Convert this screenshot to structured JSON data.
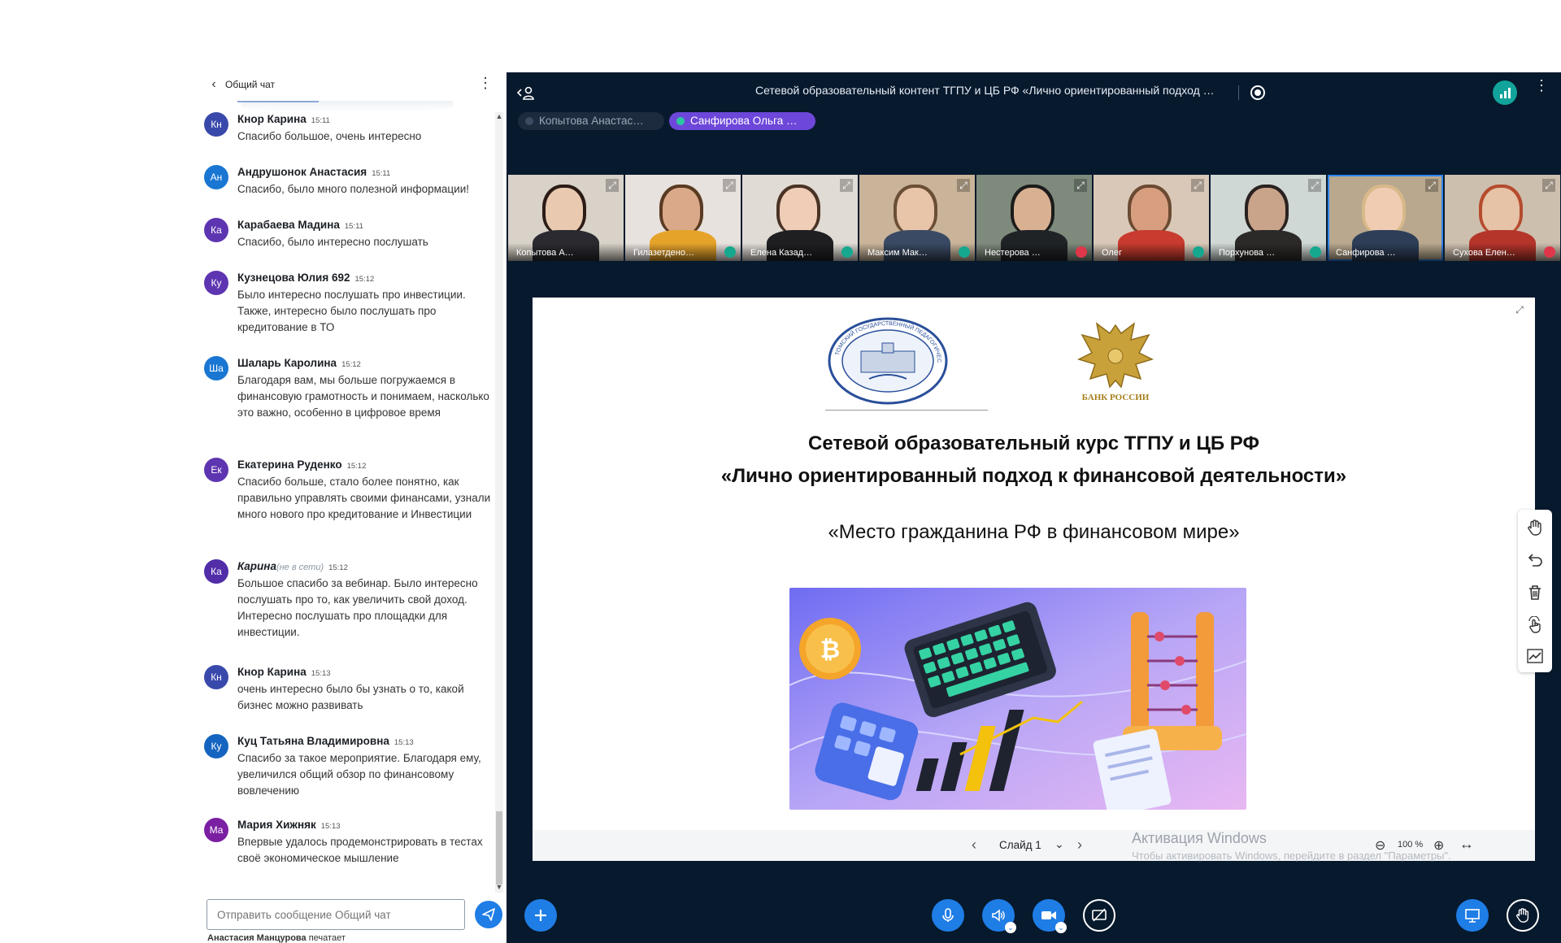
{
  "chat": {
    "title": "Общий чат",
    "messages": [
      {
        "initials": "Кн",
        "color": "#3949ab",
        "name": "Кнор Карина",
        "time": "15:11",
        "text": "Спасибо большое, очень интересно"
      },
      {
        "initials": "Ан",
        "color": "#1976d2",
        "name": "Андрушонок Анастасия",
        "time": "15:11",
        "text": "Спасибо, было много полезной информации!"
      },
      {
        "initials": "Ка",
        "color": "#5e35b1",
        "name": "Карабаева Мадина",
        "time": "15:11",
        "text": "Спасибо, было интересно послушать"
      },
      {
        "initials": "Ку",
        "color": "#5e35b1",
        "name": "Кузнецова Юлия 692",
        "time": "15:12",
        "text": "Было интересно послушать про инвестиции. Также, интересно было послушать про кредитование в ТО"
      },
      {
        "initials": "Ша",
        "color": "#1976d2",
        "name": "Шаларь Каролина",
        "time": "15:12",
        "text": "Благодаря вам, мы больше погружаемся в финансовую грамотность и понимаем, насколько это важно, особенно в цифровое время"
      },
      {
        "initials": "Ек",
        "color": "#5e35b1",
        "name": "Екатерина Руденко",
        "time": "15:12",
        "text": "Спасибо больше, стало более понятно, как правильно управлять своими финансами, узнали много нового про кредитование и Инвестиции"
      },
      {
        "initials": "Ка",
        "color": "#512da8",
        "name": "Карина",
        "offline": "(не в сети)",
        "time": "15:12",
        "text": "Большое спасибо за вебинар. Было интересно послушать про то, как увеличить свой доход. Интересно послушать про площадки для инвестиции."
      },
      {
        "initials": "Кн",
        "color": "#3949ab",
        "name": "Кнор Карина",
        "time": "15:13",
        "text": "очень интересно было бы узнать о то, какой бизнес можно развивать"
      },
      {
        "initials": "Ку",
        "color": "#1565c0",
        "name": "Куц Татьяна Владимировна",
        "time": "15:13",
        "text": "Спасибо за такое мероприятие. Благодаря ему, увеличился общий обзор по финансовому вовлечению"
      },
      {
        "initials": "Ма",
        "color": "#7b1fa2",
        "name": "Мария Хижняк",
        "time": "15:13",
        "text": "Впервые удалось продемонстрировать в тестах своё экономическое мышление"
      }
    ],
    "input_placeholder": "Отправить сообщение Общий чат",
    "typing_user": "Анастасия Манцурова",
    "typing_suffix": "печатает"
  },
  "conference": {
    "title": "Сетевой образовательный контент ТГПУ и ЦБ РФ «Лично ориентированный подход к финансовой деятельности»",
    "presenters": [
      {
        "name": "Копытова Анастас…",
        "active": false
      },
      {
        "name": "Санфирова Ольга …",
        "active": true
      }
    ],
    "participants": [
      {
        "name": "Копытова А…",
        "mic": "none",
        "bg": "#d8d2c8",
        "face": "#e9c9b0",
        "body": "#2a2a30",
        "hair": "#2b1c16"
      },
      {
        "name": "Гилазетдено…",
        "mic": "on",
        "bg": "#e8e2de",
        "face": "#d9a98a",
        "body": "#e6a32a",
        "hair": "#5a3b22"
      },
      {
        "name": "Елена Казад…",
        "mic": "on",
        "bg": "#e0dbd5",
        "face": "#efcdb7",
        "body": "#1f1f22",
        "hair": "#4a3325"
      },
      {
        "name": "Максим Мак…",
        "mic": "on",
        "bg": "#c9b49a",
        "face": "#e8c4a8",
        "body": "#3a4a64",
        "hair": "#6a4f36"
      },
      {
        "name": "Нестерова …",
        "mic": "off",
        "bg": "#7e8a7c",
        "face": "#d8b092",
        "body": "#202326",
        "hair": "#1b1b1b"
      },
      {
        "name": "Олег",
        "mic": "on",
        "bg": "#d9c8b8",
        "face": "#d79e80",
        "body": "#c83b2e",
        "hair": "#6b4a32"
      },
      {
        "name": "Порхунова …",
        "mic": "on",
        "bg": "#cfd8d4",
        "face": "#c9a48a",
        "body": "#2c2a28",
        "hair": "#2a2220"
      },
      {
        "name": "Санфирова …",
        "mic": "none",
        "bg": "#b9a88e",
        "face": "#f0cdb2",
        "body": "#2e3e58",
        "hair": "#d7b98a",
        "active": true
      },
      {
        "name": "Сухова Елен…",
        "mic": "off",
        "bg": "#cdbfae",
        "face": "#e6c2a6",
        "body": "#b5352b",
        "hair": "#b64b2e"
      }
    ],
    "slide": {
      "logo_tgpu_text": "ТОМСКИЙ ГОСУДАРСТВЕННЫЙ ПЕДАГОГИЧЕСКИЙ УНИВЕРСИТЕТ",
      "logo_bank_text": "БАНК РОССИИ",
      "heading_line1": "Сетевой образовательный курс ТГПУ и ЦБ РФ",
      "heading_line2": "«Лично ориентированный подход к финансовой деятельности»",
      "subtitle": "«Место гражданина РФ в финансовом мире»",
      "slide_label": "Слайд 1",
      "zoom": "100 %",
      "watermark_title": "Активация Windows",
      "watermark_sub": "Чтобы активировать Windows, перейдите в раздел \"Параметры\"."
    }
  }
}
